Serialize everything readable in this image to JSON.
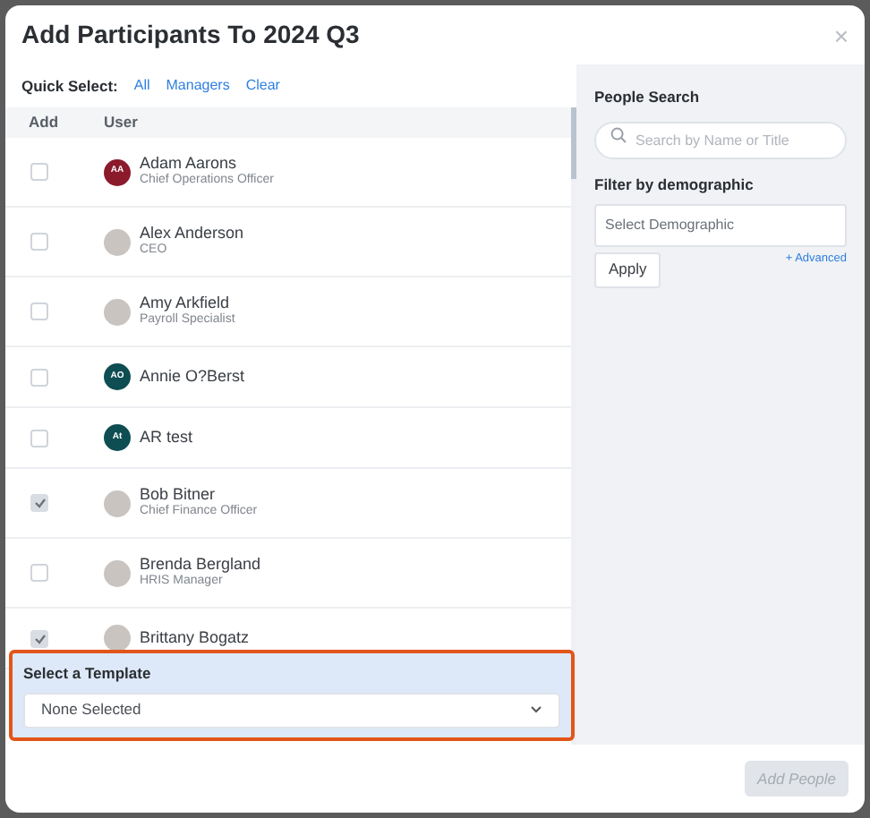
{
  "dialog": {
    "title": "Add Participants To 2024 Q3",
    "close": "×"
  },
  "quick_select": {
    "label": "Quick Select:",
    "links": [
      "All",
      "Managers",
      "Clear"
    ]
  },
  "table": {
    "columns": [
      "Add",
      "User"
    ],
    "rows": [
      {
        "checked": false,
        "name": "Adam Aarons",
        "title": "Chief Operations Officer",
        "avatar": {
          "kind": "initials",
          "initials": "AA",
          "color": "#8b1a2b"
        }
      },
      {
        "checked": false,
        "name": "Alex Anderson",
        "title": "CEO",
        "avatar": {
          "kind": "photo"
        }
      },
      {
        "checked": false,
        "name": "Amy Arkfield",
        "title": "Payroll Specialist",
        "avatar": {
          "kind": "photo"
        }
      },
      {
        "checked": false,
        "name": "Annie O?Berst",
        "avatar": {
          "kind": "initials",
          "initials": "AO",
          "color": "#0e4d52"
        }
      },
      {
        "checked": false,
        "name": "AR test",
        "avatar": {
          "kind": "initials",
          "initials": "At",
          "color": "#0e4d52"
        }
      },
      {
        "checked": true,
        "name": "Bob Bitner",
        "title": "Chief Finance Officer",
        "avatar": {
          "kind": "photo"
        }
      },
      {
        "checked": false,
        "name": "Brenda Bergland",
        "title": "HRIS Manager",
        "avatar": {
          "kind": "photo"
        }
      },
      {
        "checked": true,
        "name": "Brittany Bogatz",
        "avatar": {
          "kind": "photo"
        }
      }
    ]
  },
  "template": {
    "label": "Select a Template",
    "value": "None Selected"
  },
  "people_search": {
    "label": "People Search",
    "placeholder": "Search by Name or Title"
  },
  "demographic_filter": {
    "label": "Filter by demographic",
    "placeholder": "Select Demographic",
    "apply": "Apply",
    "advanced": "+ Advanced"
  },
  "footer": {
    "add_button": "Add People"
  }
}
